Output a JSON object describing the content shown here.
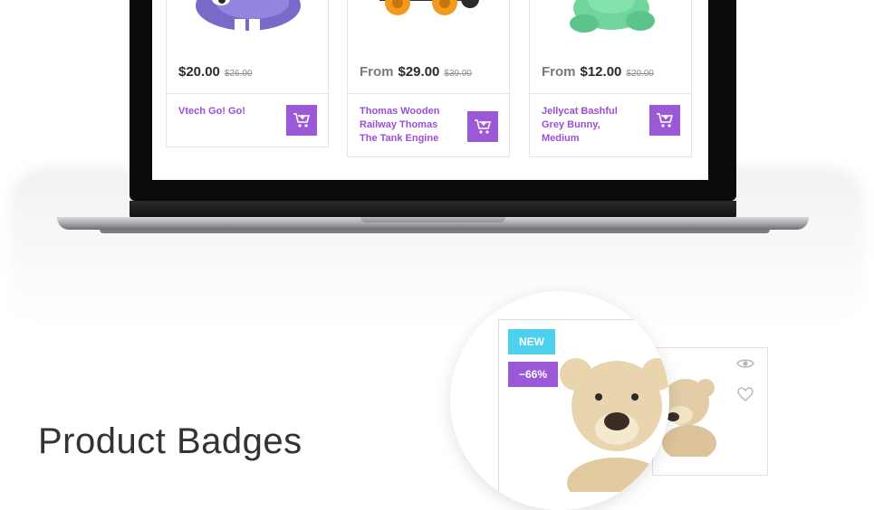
{
  "products": [
    {
      "from_label": "",
      "price": "$20.00",
      "old_price": "$26.00",
      "title_lines": [
        "Vtech Go! Go!"
      ],
      "cart_icon": "add-to-cart-icon"
    },
    {
      "from_label": "From",
      "price": "$29.00",
      "old_price": "$39.00",
      "title_lines": [
        "Thomas Wooden",
        "Railway Thomas",
        "The Tank Engine"
      ],
      "cart_icon": "add-to-cart-icon"
    },
    {
      "from_label": "From",
      "price": "$12.00",
      "old_price": "$20.00",
      "title_lines": [
        "Jellycat Bashful",
        "Grey Bunny, Medium"
      ],
      "cart_icon": "add-to-cart-icon"
    }
  ],
  "badges": {
    "new": "NEW",
    "sale": "−66%"
  },
  "section": {
    "heading": "Product Badges"
  },
  "icons": {
    "quick_view": "eye-icon",
    "wishlist": "heart-icon"
  },
  "colors": {
    "accent": "#9b59d8",
    "new_badge": "#4dd0ec"
  }
}
